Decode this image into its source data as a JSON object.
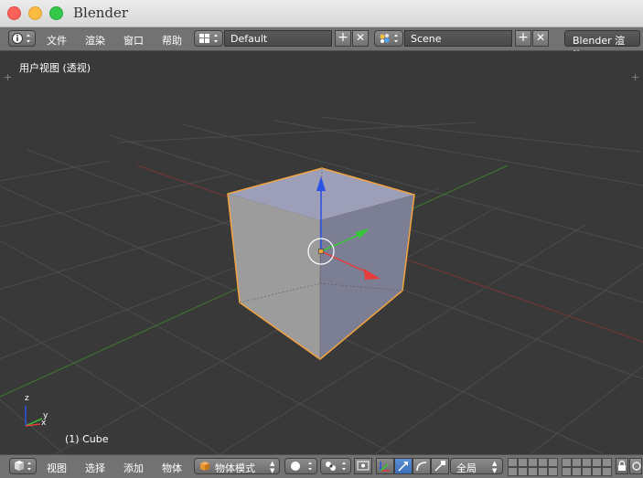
{
  "window": {
    "title": "Blender"
  },
  "header": {
    "menus": [
      "文件",
      "渲染",
      "窗口",
      "帮助"
    ],
    "screen_layout": "Default",
    "scene": "Scene",
    "render_engine": "Blender 渲染"
  },
  "viewport": {
    "view_label": "用户视图 (透视)",
    "object_label": "(1) Cube",
    "axis_labels": {
      "x": "x",
      "y": "y",
      "z": "z"
    }
  },
  "footer": {
    "menus": [
      "视图",
      "选择",
      "添加",
      "物体"
    ],
    "mode": "物体模式",
    "transform_orientation": "全局"
  },
  "colors": {
    "background": "#393939",
    "header": "#727272",
    "selection_outline": "#f5a540",
    "axis_x": "#e63c3c",
    "axis_y": "#37c837",
    "axis_z": "#2a52e6"
  }
}
